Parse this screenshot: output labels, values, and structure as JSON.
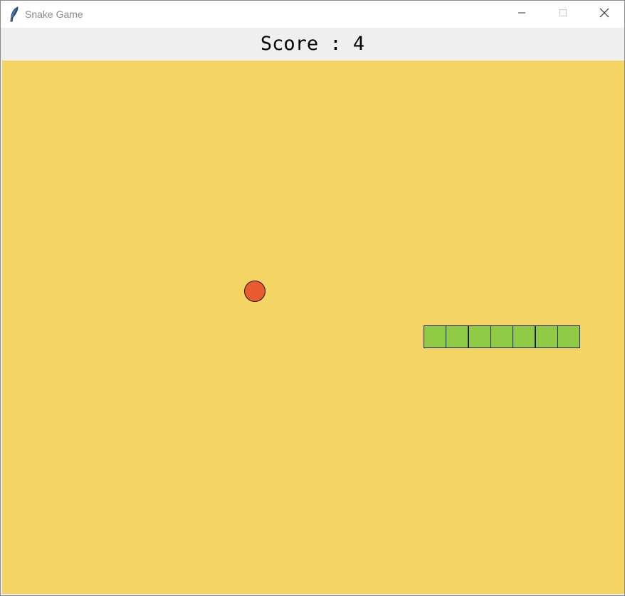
{
  "window": {
    "title": "Snake Game",
    "app_icon": "feather-icon",
    "controls": {
      "minimize_icon": "minimize-icon",
      "maximize_icon": "maximize-icon",
      "close_icon": "close-icon"
    }
  },
  "score": {
    "label": "Score",
    "value": 4,
    "display": "Score : 4"
  },
  "board": {
    "background_color": "#f4d563",
    "food": {
      "color": "#ea5a2e",
      "shape": "circle"
    },
    "snake": {
      "color": "#8fcb44",
      "segment_count": 7,
      "direction": "horizontal"
    }
  }
}
